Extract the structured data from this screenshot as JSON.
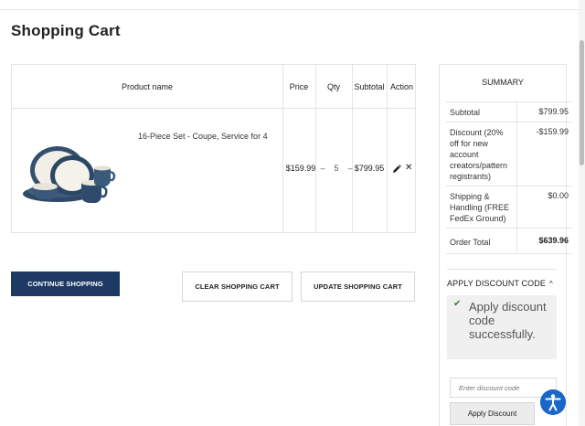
{
  "page": {
    "title": "Shopping Cart"
  },
  "cart": {
    "headers": {
      "product": "Product name",
      "price": "Price",
      "qty": "Qty",
      "subtotal": "Subtotal",
      "action": "Action"
    },
    "items": [
      {
        "name": "16-Piece Set - Coupe, Service for 4",
        "price": "$159.99",
        "qty_minus": "–",
        "qty": "5",
        "qty_plus": "–",
        "subtotal": "$799.95",
        "edit_icon": "pencil-icon",
        "delete_icon": "close-icon",
        "delete_glyph": "✕"
      }
    ]
  },
  "buttons": {
    "continue": "CONTINUE SHOPPING",
    "clear": "CLEAR SHOPPING CART",
    "update": "UPDATE SHOPPING CART"
  },
  "summary": {
    "title": "SUMMARY",
    "rows": [
      {
        "label": "Subtotal",
        "value": "$799.95"
      },
      {
        "label": "Discount (20% off for new account creators/pattern registrants)",
        "value": "-$159.99"
      },
      {
        "label": "Shipping & Handling (FREE FedEx Ground)",
        "value": "$0.00"
      },
      {
        "label": "Order Total",
        "value": "$639.96"
      }
    ],
    "discount": {
      "toggle_label": "APPLY DISCOUNT CODE",
      "chevron": "^",
      "success_icon": "✔",
      "success_message": "Apply discount code successfully.",
      "input_placeholder": "Enter discount code",
      "apply_label": "Apply Discount"
    }
  },
  "colors": {
    "primary": "#1e3a64",
    "accessibility": "#1b66c9",
    "success": "#2f7d3a"
  }
}
